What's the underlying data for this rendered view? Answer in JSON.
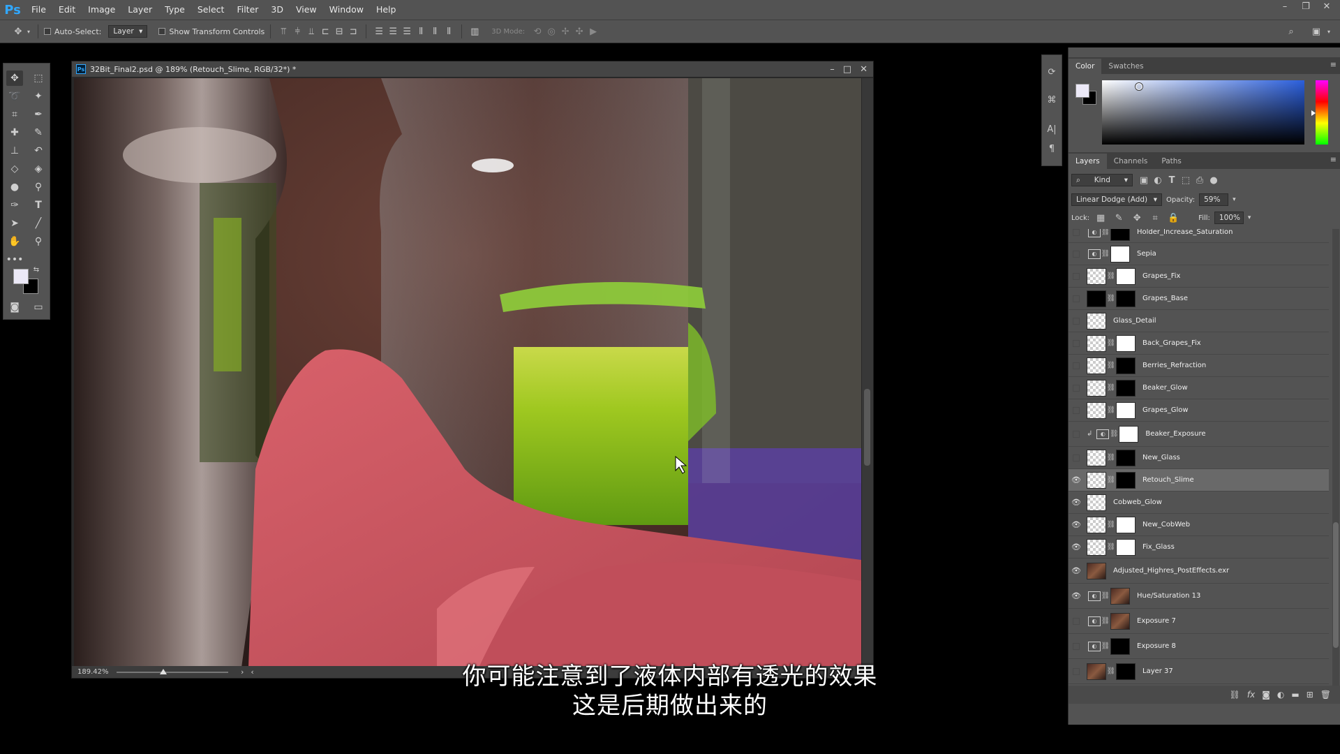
{
  "app": {
    "logo": "Ps",
    "menu": [
      "File",
      "Edit",
      "Image",
      "Layer",
      "Type",
      "Select",
      "Filter",
      "3D",
      "View",
      "Window",
      "Help"
    ]
  },
  "options_bar": {
    "auto_select_label": "Auto-Select:",
    "auto_select_target": "Layer",
    "show_transform_label": "Show Transform Controls",
    "mode_3d_label": "3D Mode:"
  },
  "document": {
    "title": "32Bit_Final2.psd @ 189% (Retouch_Slime, RGB/32*) *",
    "zoom": "189.42%",
    "zoom_slider_fraction": 0.42
  },
  "color_panel": {
    "tabs": [
      "Color",
      "Swatches"
    ],
    "foreground": "#ece9f7",
    "background": "#000000"
  },
  "layers_panel": {
    "tabs": [
      "Layers",
      "Channels",
      "Paths"
    ],
    "filter_kind": "Kind",
    "blend_mode": "Linear Dodge (Add)",
    "opacity_label": "Opacity:",
    "opacity_value": "59%",
    "lock_label": "Lock:",
    "fill_label": "Fill:",
    "fill_value": "100%",
    "layers": [
      {
        "name": "Holder_Increase_Saturation",
        "visible": false,
        "thumb": "adj",
        "mask": "black"
      },
      {
        "name": "Sepia",
        "visible": false,
        "thumb": "adj",
        "mask": "white"
      },
      {
        "name": "Grapes_Fix",
        "visible": false,
        "thumb": "checker",
        "mask": "white"
      },
      {
        "name": "Grapes_Base",
        "visible": false,
        "thumb": "black",
        "mask": "black"
      },
      {
        "name": "Glass_Detail",
        "visible": false,
        "thumb": "checker",
        "mask": null
      },
      {
        "name": "Back_Grapes_Fix",
        "visible": false,
        "thumb": "checker",
        "mask": "white"
      },
      {
        "name": "Berries_Refraction",
        "visible": false,
        "thumb": "checker",
        "mask": "black"
      },
      {
        "name": "Beaker_Glow",
        "visible": false,
        "thumb": "checker",
        "mask": "black"
      },
      {
        "name": "Grapes_Glow",
        "visible": false,
        "thumb": "checker",
        "mask": "white"
      },
      {
        "name": "Beaker_Exposure",
        "visible": false,
        "thumb": "adj",
        "mask": "white",
        "clipped": true
      },
      {
        "name": "New_Glass",
        "visible": false,
        "thumb": "checker",
        "mask": "black"
      },
      {
        "name": "Retouch_Slime",
        "visible": true,
        "thumb": "checker",
        "mask": "black",
        "selected": true
      },
      {
        "name": "Cobweb_Glow",
        "visible": true,
        "thumb": "checker",
        "mask": null
      },
      {
        "name": "New_CobWeb",
        "visible": true,
        "thumb": "checker",
        "mask": "white"
      },
      {
        "name": "Fix_Glass",
        "visible": true,
        "thumb": "checker",
        "mask": "white"
      },
      {
        "name": "Adjusted_Highres_PostEffects.exr",
        "visible": true,
        "thumb": "photo",
        "mask": null
      },
      {
        "name": "Hue/Saturation 13",
        "visible": true,
        "thumb": "adj",
        "mask": "photo"
      },
      {
        "name": "Exposure 7",
        "visible": false,
        "thumb": "adj",
        "mask": "photo"
      },
      {
        "name": "Exposure 8",
        "visible": false,
        "thumb": "adj",
        "mask": "black"
      },
      {
        "name": "Layer 37",
        "visible": false,
        "thumb": "photo",
        "mask": "black"
      }
    ]
  },
  "subtitle": {
    "line1": "你可能注意到了液体内部有透光的效果",
    "line2": "这是后期做出来的"
  }
}
